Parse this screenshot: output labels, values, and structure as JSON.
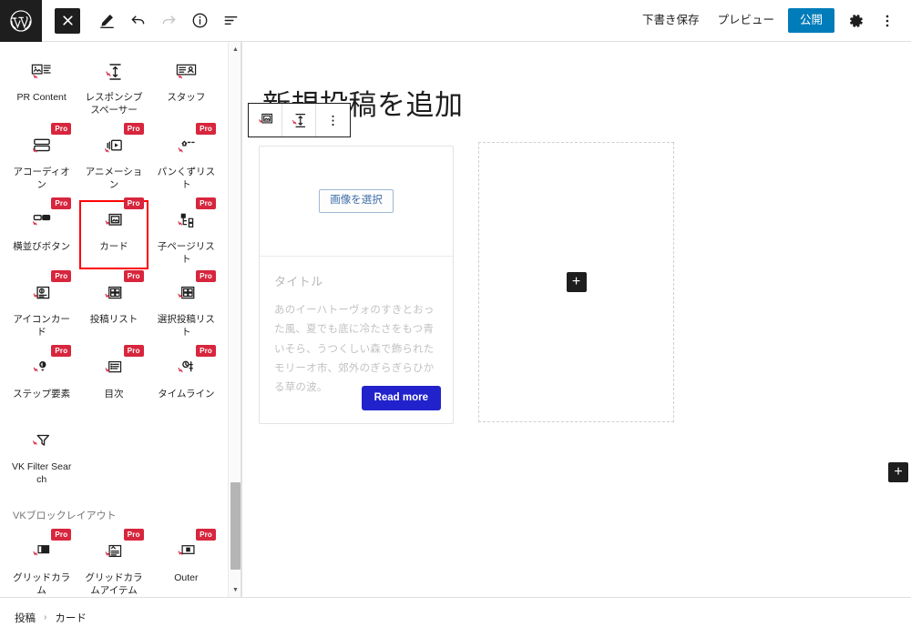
{
  "colors": {
    "brand_dark": "#1e1e1e",
    "publish_blue": "#007cba",
    "pro_red": "#d7263d",
    "highlight_red": "#ff0000",
    "read_more_blue": "#2222cc",
    "select_image_blue": "#3f6ea8"
  },
  "topbar": {
    "logo_icon": "wordpress-logo-icon",
    "left_buttons": [
      {
        "name": "close-inserter-button",
        "icon": "close-x-icon",
        "state": "active"
      },
      {
        "name": "edit-tool-button",
        "icon": "pencil-icon",
        "state": "default"
      },
      {
        "name": "undo-button",
        "icon": "undo-arrow-icon",
        "state": "default"
      },
      {
        "name": "redo-button",
        "icon": "redo-arrow-icon",
        "state": "disabled"
      },
      {
        "name": "details-button",
        "icon": "info-circle-icon",
        "state": "default"
      },
      {
        "name": "list-view-button",
        "icon": "list-view-icon",
        "state": "default"
      }
    ],
    "save_draft_label": "下書き保存",
    "preview_label": "プレビュー",
    "publish_label": "公開",
    "settings_icon": "gear-icon",
    "more_options_icon": "more-vertical-icon"
  },
  "inserter": {
    "blocks": [
      {
        "label": "PR Content",
        "icon": "pr-content-icon",
        "pro": false,
        "highlighted": false
      },
      {
        "label": "レスポンシブスペーサー",
        "icon": "responsive-spacer-icon",
        "pro": false,
        "highlighted": false
      },
      {
        "label": "スタッフ",
        "icon": "staff-icon",
        "pro": false,
        "highlighted": false
      },
      {
        "label": "アコーディオン",
        "icon": "accordion-icon",
        "pro": true,
        "highlighted": false
      },
      {
        "label": "アニメーション",
        "icon": "animation-icon",
        "pro": true,
        "highlighted": false
      },
      {
        "label": "パンくずリスト",
        "icon": "breadcrumb-icon",
        "pro": true,
        "highlighted": false
      },
      {
        "label": "横並びボタン",
        "icon": "button-row-icon",
        "pro": true,
        "highlighted": false
      },
      {
        "label": "カード",
        "icon": "card-icon",
        "pro": true,
        "highlighted": true
      },
      {
        "label": "子ページリスト",
        "icon": "child-page-list-icon",
        "pro": true,
        "highlighted": false
      },
      {
        "label": "アイコンカード",
        "icon": "icon-card-icon",
        "pro": true,
        "highlighted": false
      },
      {
        "label": "投稿リスト",
        "icon": "post-list-icon",
        "pro": true,
        "highlighted": false
      },
      {
        "label": "選択投稿リスト",
        "icon": "selected-post-list-icon",
        "pro": true,
        "highlighted": false
      },
      {
        "label": "ステップ要素",
        "icon": "step-element-icon",
        "pro": true,
        "highlighted": false
      },
      {
        "label": "目次",
        "icon": "table-of-contents-icon",
        "pro": true,
        "highlighted": false
      },
      {
        "label": "タイムライン",
        "icon": "timeline-icon",
        "pro": true,
        "highlighted": false
      },
      {
        "label": "VK Filter Search",
        "icon": "filter-search-icon",
        "pro": false,
        "highlighted": false
      }
    ],
    "group_title": "VKブロックレイアウト",
    "layout_blocks": [
      {
        "label": "グリッドカラム",
        "icon": "grid-column-icon",
        "pro": true
      },
      {
        "label": "グリッドカラムアイテム",
        "icon": "grid-column-item-icon",
        "pro": true
      },
      {
        "label": "Outer",
        "icon": "outer-icon",
        "pro": true
      }
    ],
    "scrollbar": {
      "name": "inserter-scrollbar",
      "up_arrow": "▲",
      "down_arrow": "▼"
    }
  },
  "editor": {
    "post_title": "新規投稿を追加",
    "block_toolbar": [
      {
        "name": "block-type-card-button",
        "icon": "card-icon"
      },
      {
        "name": "responsive-spacer-button",
        "icon": "responsive-spacer-icon"
      },
      {
        "name": "block-more-options-button",
        "icon": "more-vertical-icon"
      }
    ],
    "card": {
      "select_image_label": "画像を選択",
      "title_placeholder": "タイトル",
      "body_text": "あのイーハトーヴォのすきとおった風、夏でも底に冷たさをもつ青いそら、うつくしい森で飾られたモリーオ市、郊外のぎらぎらひかる草の波。",
      "read_more_label": "Read more"
    },
    "appender": {
      "name": "block-appender-placeholder",
      "plus_label": "+"
    },
    "standalone_appender": {
      "name": "add-block-button",
      "plus_label": "+"
    }
  },
  "footer": {
    "breadcrumb": [
      {
        "label": "投稿"
      },
      {
        "label": "カード"
      }
    ],
    "separator": "›"
  }
}
